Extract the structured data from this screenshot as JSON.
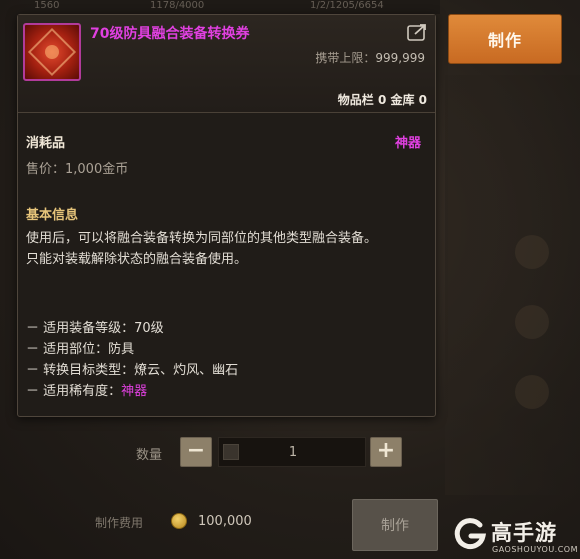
{
  "top_bar": {
    "values": [
      "1560",
      "1178/4000",
      "1/2/1205/6654"
    ]
  },
  "craft_top": {
    "label": "制作"
  },
  "tooltip": {
    "item_name": "70级防具融合装备转换券",
    "carry_limit_label": "携带上限：",
    "carry_limit_value": "999,999",
    "storage_text": "物品栏 0 金库 0",
    "category": "消耗品",
    "rarity": "神器",
    "price": "售价：1,000金币",
    "section_title": "基本信息",
    "description": [
      "使用后，可以将融合装备转换为同部位的其他类型融合装备。",
      "只能对装载解除状态的融合装备使用。"
    ],
    "properties": [
      {
        "text": "－ 适用装备等级：70级",
        "highlight": ""
      },
      {
        "text": "－ 适用部位：防具",
        "highlight": ""
      },
      {
        "text": "－ 转换目标类型：燎云、灼风、幽石",
        "highlight": ""
      },
      {
        "text": "－ 适用稀有度：",
        "highlight": "神器"
      }
    ]
  },
  "quantity": {
    "label": "数量",
    "minus": "−",
    "plus": "+",
    "value": "1"
  },
  "cost": {
    "label": "制作费用",
    "value": "100,000"
  },
  "craft_bottom": {
    "label": "制作"
  },
  "watermark": {
    "title": "高手游",
    "subtitle": "GAOSHOUYOU.COM"
  },
  "colors": {
    "epic": "#e040e0",
    "accent_button": "#d97a30",
    "section_gold": "#e6c47a"
  },
  "icons": {
    "item": "artifact-voucher-icon",
    "share": "share-icon",
    "coin": "gold-coin-icon"
  }
}
